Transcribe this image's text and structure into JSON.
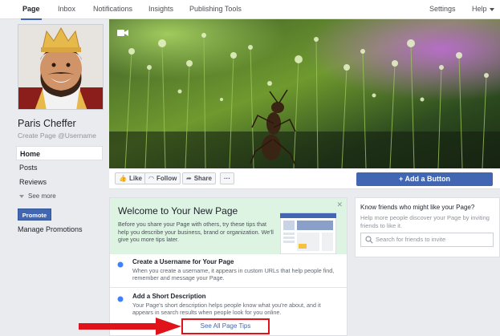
{
  "nav": {
    "tabs": [
      {
        "label": "Page",
        "active": true
      },
      {
        "label": "Inbox"
      },
      {
        "label": "Notifications"
      },
      {
        "label": "Insights"
      },
      {
        "label": "Publishing Tools"
      }
    ],
    "settings": "Settings",
    "help": "Help"
  },
  "profile": {
    "name": "Paris Cheffer",
    "username_prompt": "Create Page @Username"
  },
  "sidebar": {
    "items": [
      {
        "label": "Home",
        "active": true
      },
      {
        "label": "Posts"
      },
      {
        "label": "Reviews"
      }
    ],
    "see_more": "See more",
    "promote": "Promote",
    "manage_promotions": "Manage Promotions"
  },
  "actions": {
    "like": "Like",
    "follow": "Follow",
    "share": "Share",
    "more": "···",
    "add_button": "+ Add a Button"
  },
  "welcome": {
    "title": "Welcome to Your New Page",
    "text": "Before you share your Page with others, try these tips that help you describe your business, brand or organization. We'll give you more tips later.",
    "close": "✕",
    "tips": [
      {
        "title": "Create a Username for Your Page",
        "desc": "When you create a username, it appears in custom URLs that help people find, remember and message your Page."
      },
      {
        "title": "Add a Short Description",
        "desc": "Your Page's short description helps people know what you're about, and it appears in search results when people look for you online."
      }
    ],
    "see_all": "See All Page Tips"
  },
  "friends": {
    "title": "Know friends who might like your Page?",
    "desc": "Help more people discover your Page by inviting friends to like it.",
    "search_placeholder": "Search for friends to invite"
  },
  "colors": {
    "brand": "#4267b2",
    "highlight_box": "#e0131a",
    "arrow": "#e0131a",
    "welcome_bg": "#ddf4e3"
  }
}
